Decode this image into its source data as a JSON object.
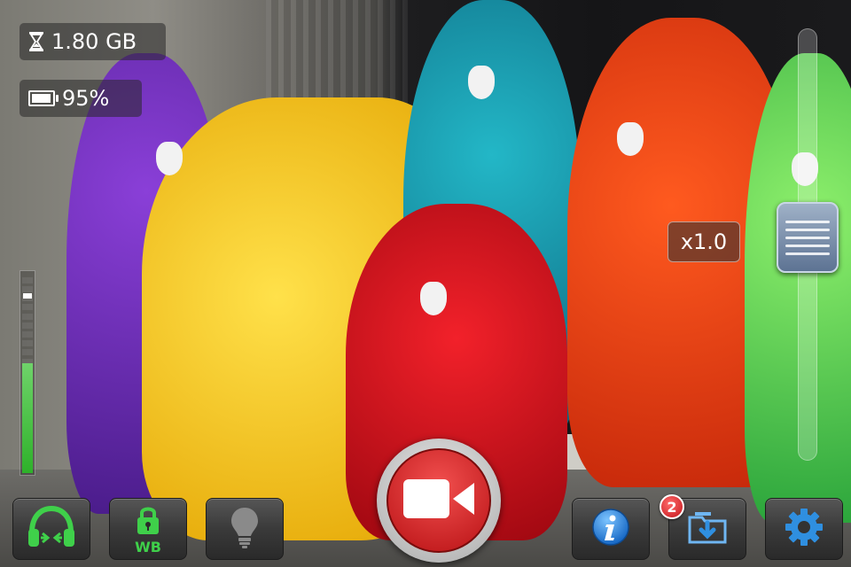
{
  "status": {
    "storage_text": "1.80 GB",
    "storage_icon": "hourglass-icon",
    "battery_text": "95%",
    "battery_icon": "battery-icon",
    "battery_level": 0.95
  },
  "audio_meter": {
    "level": 0.55,
    "peak": 0.88
  },
  "zoom": {
    "label": "x1.0",
    "position": 0.45
  },
  "toolbar": {
    "headphones_icon": "headphones-icon",
    "wb_lock_icon": "lock-icon",
    "wb_label": "WB",
    "light_icon": "lightbulb-icon",
    "record_icon": "video-camera-icon",
    "info_icon": "info-icon",
    "gallery_icon": "folder-download-icon",
    "gallery_badge": "2",
    "settings_icon": "gear-icon"
  },
  "colors": {
    "accent_green": "#3fd04a",
    "record_red": "#d8282a",
    "info_blue": "#2f8fe0"
  }
}
